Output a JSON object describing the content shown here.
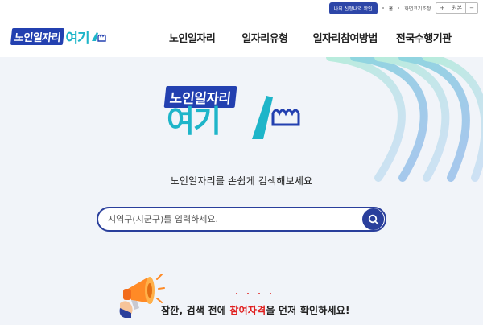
{
  "util_bar": {
    "apply_check_label": "나의 신청내역 확인",
    "home_label": "홈",
    "font_size_label": "화면크기조정",
    "zoom_in": "+",
    "zoom_reset": "원본",
    "zoom_out": "−"
  },
  "header": {
    "logo_box_text": "노인일자리",
    "logo_here_text": "여기",
    "nav": [
      "노인일자리",
      "일자리유형",
      "일자리참여방법",
      "전국수행기관"
    ]
  },
  "hero": {
    "logo_box_text": "노인일자리",
    "logo_here_text": "여기",
    "tagline": "노인일자리를 손쉽게 검색해보세요",
    "search": {
      "placeholder": "지역구(시군구)를 입력하세요.",
      "value": ""
    },
    "notice_prefix": "잠깐, 검색 전에 ",
    "notice_highlight": "참여자격",
    "notice_suffix": "을 먼저 확인하세요!"
  },
  "colors": {
    "brand_blue": "#2340b0",
    "brand_cyan": "#1eb5c9",
    "search_border": "#2a3f9c",
    "highlight_red": "#e02020",
    "hero_bg": "#f1f4f9"
  },
  "icons": {
    "search": "search-icon",
    "megaphone": "megaphone-icon"
  }
}
